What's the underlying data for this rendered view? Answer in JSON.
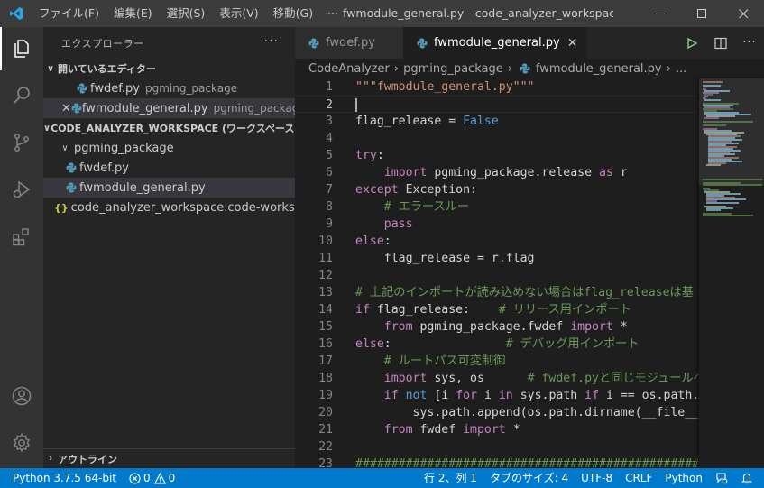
{
  "titlebar": {
    "menu": [
      "ファイル(F)",
      "編集(E)",
      "選択(S)",
      "表示(V)",
      "移動(G)",
      "···"
    ],
    "title": "fwmodule_general.py - code_analyzer_workspace (ワークスペース) - Visual Studio Code"
  },
  "sidebar": {
    "header": "エクスプローラー",
    "more": "···",
    "open_editors": {
      "title": "開いているエディター",
      "items": [
        {
          "name": "fwdef.py",
          "desc": "pgming_package"
        },
        {
          "name": "fwmodule_general.py",
          "desc": "pgming_package"
        }
      ]
    },
    "workspace": {
      "title": "CODE_ANALYZER_WORKSPACE (ワークスペース)",
      "folder": "pgming_package",
      "files": [
        "fwdef.py",
        "fwmodule_general.py"
      ],
      "workspace_file": "code_analyzer_workspace.code-workspace"
    },
    "outline": "アウトライン"
  },
  "editor": {
    "tabs": [
      {
        "label": "fwdef.py",
        "active": false
      },
      {
        "label": "fwmodule_general.py",
        "active": true
      }
    ],
    "breadcrumb": [
      "CodeAnalyzer",
      "pgming_package",
      "fwmodule_general.py",
      "..."
    ]
  },
  "code_lines": [
    {
      "n": "1",
      "html": "<span class=\"s\">\"\"\"fwmodule_general.py\"\"\"</span>"
    },
    {
      "n": "2",
      "html": ""
    },
    {
      "n": "3",
      "html": "flag_release = <span class=\"kb\">False</span>"
    },
    {
      "n": "4",
      "html": ""
    },
    {
      "n": "5",
      "html": "<span class=\"k\">try</span>:"
    },
    {
      "n": "6",
      "html": "    <span class=\"k\">import</span> pgming_package.release <span class=\"k\">as</span> r"
    },
    {
      "n": "7",
      "html": "<span class=\"k\">except</span> Exception:"
    },
    {
      "n": "8",
      "html": "    <span class=\"c\"># エラースルー</span>"
    },
    {
      "n": "9",
      "html": "    <span class=\"k\">pass</span>"
    },
    {
      "n": "10",
      "html": "<span class=\"k\">else</span>:"
    },
    {
      "n": "11",
      "html": "    flag_release = r.flag"
    },
    {
      "n": "12",
      "html": ""
    },
    {
      "n": "13",
      "html": "<span class=\"c\"># 上記のインポートが読み込めない場合はflag_releaseは基</span>"
    },
    {
      "n": "14",
      "html": "<span class=\"k\">if</span> flag_release:    <span class=\"c\"># リリース用インポート</span>"
    },
    {
      "n": "15",
      "html": "    <span class=\"k\">from</span> pgming_package.fwdef <span class=\"k\">import</span> *"
    },
    {
      "n": "16",
      "html": "<span class=\"k\">else</span>:                <span class=\"c\"># デバッグ用インポート</span>"
    },
    {
      "n": "17",
      "html": "    <span class=\"c\"># ルートパス可変制御</span>"
    },
    {
      "n": "18",
      "html": "    <span class=\"k\">import</span> sys, os      <span class=\"c\"># fwdef.pyと同じモジュールへ</span>"
    },
    {
      "n": "19",
      "html": "    <span class=\"k\">if</span> <span class=\"kb\">not</span> [i <span class=\"k\">for</span> i <span class=\"k\">in</span> sys.path <span class=\"k\">if</span> i == os.path.di"
    },
    {
      "n": "20",
      "html": "        sys.path.append(os.path.dirname(__file__))"
    },
    {
      "n": "21",
      "html": "    <span class=\"k\">from</span> fwdef <span class=\"k\">import</span> *"
    },
    {
      "n": "22",
      "html": ""
    },
    {
      "n": "23",
      "html": "<span class=\"sh\">####################################################</span>"
    }
  ],
  "statusbar": {
    "python": "Python 3.7.5 64-bit",
    "errors": "0",
    "warnings": "0",
    "position": "行 2、列 1",
    "tabsize": "タブのサイズ: 4",
    "encoding": "UTF-8",
    "eol": "CRLF",
    "language": "Python"
  },
  "colors": {
    "statusbar": "#007acc",
    "activitybar": "#333333",
    "sidebar": "#252526",
    "editor": "#1e1e1e",
    "python_icon": "#519aba"
  },
  "icons": [
    "vscode-logo-icon",
    "explorer-icon",
    "search-icon",
    "source-control-icon",
    "debug-icon",
    "extensions-icon",
    "account-icon",
    "settings-gear-icon",
    "run-icon",
    "split-editor-icon",
    "more-actions-icon",
    "feedback-icon",
    "bell-icon"
  ]
}
